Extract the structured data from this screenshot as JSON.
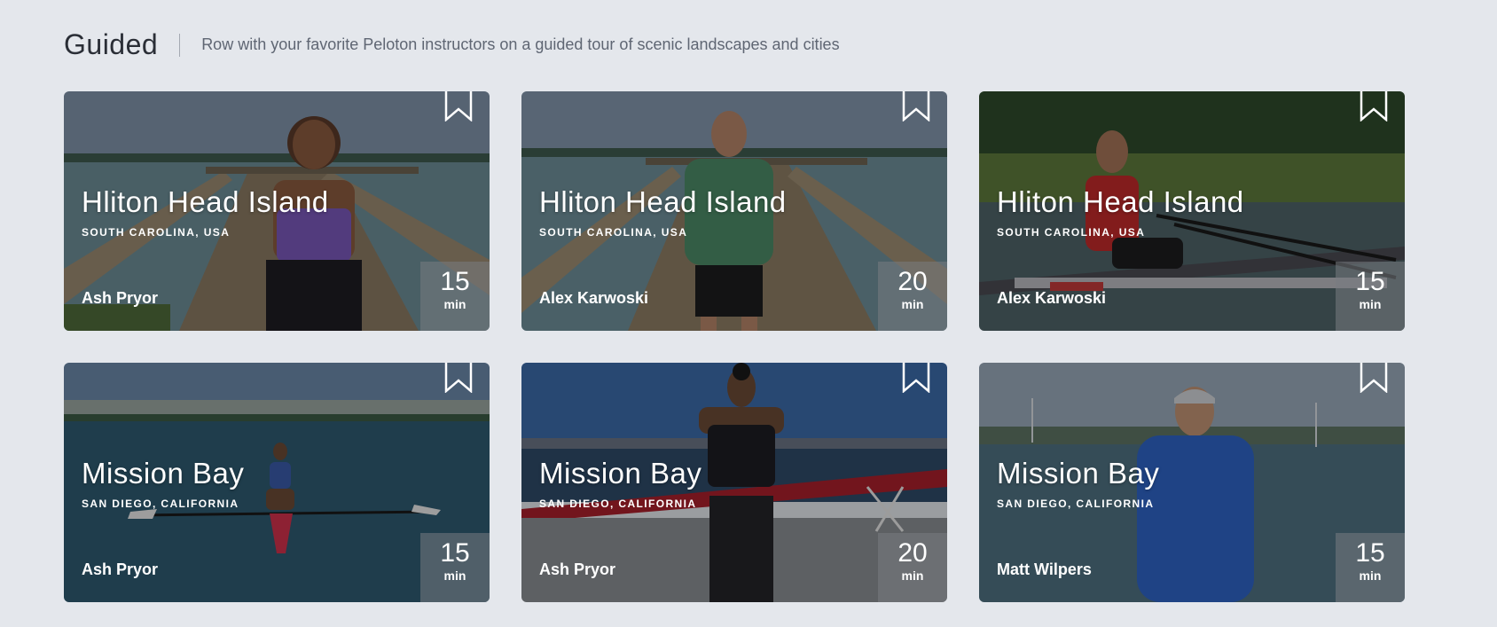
{
  "section": {
    "title": "Guided",
    "subtitle": "Row with your favorite Peloton instructors on a guided tour of scenic landscapes and cities"
  },
  "icons": {
    "bookmark": "bookmark-icon"
  },
  "cards": [
    {
      "title": "Hliton Head Island",
      "location": "SOUTH CAROLINA, USA",
      "instructor": "Ash Pryor",
      "duration": "15",
      "unit": "min"
    },
    {
      "title": "Hliton Head Island",
      "location": "SOUTH CAROLINA, USA",
      "instructor": "Alex Karwoski",
      "duration": "20",
      "unit": "min"
    },
    {
      "title": "Hliton Head Island",
      "location": "SOUTH CAROLINA, USA",
      "instructor": "Alex Karwoski",
      "duration": "15",
      "unit": "min"
    },
    {
      "title": "Mission Bay",
      "location": "SAN DIEGO, CALIFORNIA",
      "instructor": "Ash Pryor",
      "duration": "15",
      "unit": "min"
    },
    {
      "title": "Mission Bay",
      "location": "SAN DIEGO, CALIFORNIA",
      "instructor": "Ash Pryor",
      "duration": "20",
      "unit": "min"
    },
    {
      "title": "Mission Bay",
      "location": "SAN DIEGO, CALIFORNIA",
      "instructor": "Matt Wilpers",
      "duration": "15",
      "unit": "min"
    }
  ]
}
